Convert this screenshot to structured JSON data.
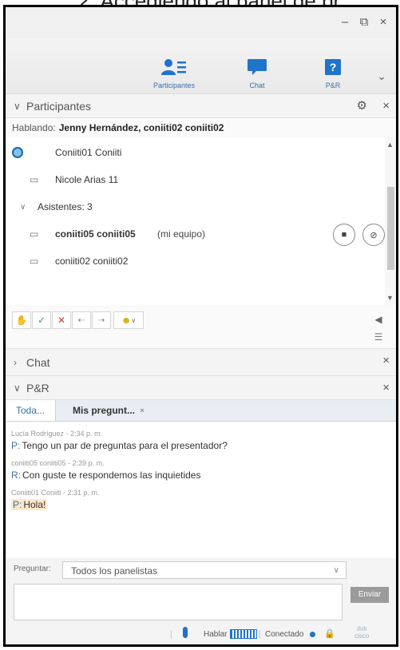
{
  "doc_heading": "2.   Accediendo al panel de pr",
  "window_controls": {
    "minimize": "–",
    "restore": "⧉",
    "close": "×"
  },
  "toolbar": {
    "buttons": [
      {
        "label": "Participantes"
      },
      {
        "label": "Chat"
      },
      {
        "label": "P&R"
      }
    ],
    "more": "⌄"
  },
  "participants_panel": {
    "title": "Participantes",
    "speaking_label": "Hablando:",
    "speaking_names": "Jenny Hernández, coniiti02 coniiti02",
    "rows": [
      {
        "name": "Coniiti01 Coniiti",
        "suffix": ""
      },
      {
        "name": "Nicole Arias 11",
        "suffix": ""
      },
      {
        "name": "Asistentes: 3",
        "suffix": ""
      },
      {
        "name": "coniiti05 coniiti05",
        "suffix": "(mi equipo)"
      },
      {
        "name": "coniiti02 coniiti02",
        "suffix": ""
      }
    ]
  },
  "chat_panel": {
    "title": "Chat"
  },
  "qa_panel": {
    "title": "P&R",
    "tabs": [
      {
        "label": "Toda..."
      },
      {
        "label": "Mis pregunt..."
      }
    ],
    "messages": [
      {
        "meta": "Lucía Rodríguez - 2:34 p. m.",
        "prefix": "P:",
        "text": "Tengo un par de preguntas para el presentador?"
      },
      {
        "meta": "coniiti05 coniiti05 - 2:39 p. m.",
        "prefix": "R:",
        "text": "Con guste te respondemos las inquietides"
      },
      {
        "meta": "Coniiti01 Coniiti - 2:31 p. m.",
        "prefix": "P:",
        "text": "Hola!"
      }
    ],
    "ask_label": "Preguntar:",
    "ask_target": "Todos los panelistas",
    "send_label": "Enviar"
  },
  "status": {
    "talk_label": "Hablar",
    "connected_label": "Conectado",
    "brand": "cisco"
  },
  "colors": {
    "accent": "#1f73c9",
    "link": "#3a6ea8",
    "highlight": "#ffe7cc"
  }
}
